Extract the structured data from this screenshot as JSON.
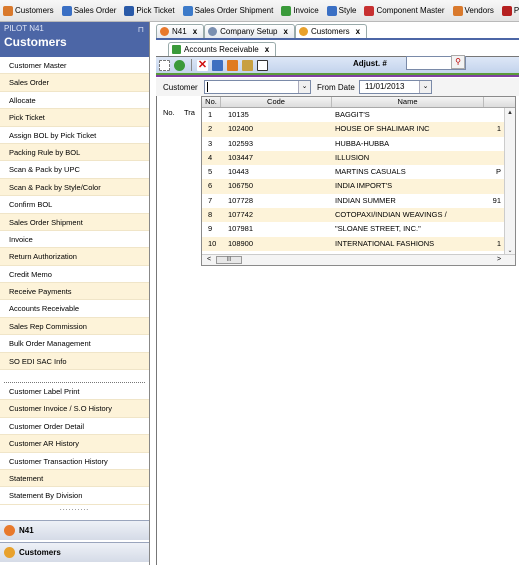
{
  "toolbar": {
    "items": [
      {
        "label": "Customers",
        "icon": "customers-icon",
        "color": "#d9792c"
      },
      {
        "label": "Sales Order",
        "icon": "sales-order-icon",
        "color": "#3a6fc4"
      },
      {
        "label": "Pick Ticket",
        "icon": "pick-ticket-icon",
        "color": "#2a5aa8"
      },
      {
        "label": "Sales Order Shipment",
        "icon": "shipment-icon",
        "color": "#3c7ac9"
      },
      {
        "label": "Invoice",
        "icon": "invoice-icon",
        "color": "#3a9a3a"
      },
      {
        "label": "Style",
        "icon": "style-icon",
        "color": "#3a6fc4"
      },
      {
        "label": "Component Master",
        "icon": "component-master-icon",
        "color": "#c73030"
      },
      {
        "label": "Vendors",
        "icon": "vendors-icon",
        "color": "#d9792c"
      },
      {
        "label": "Pr",
        "icon": "production-icon",
        "color": "#b52020"
      }
    ]
  },
  "sidebar": {
    "subtitle": "PILOT N41",
    "title": "Customers",
    "pin": "⊓",
    "items": [
      "Customer Master",
      "Sales Order",
      "Allocate",
      "Pick Ticket",
      "Assign BOL by Pick Ticket",
      "Packing Rule by BOL",
      "Scan & Pack by UPC",
      "Scan & Pack by Style/Color",
      "Confirm BOL",
      "Sales Order Shipment",
      "Invoice",
      "Return Authorization",
      "Credit Memo",
      "Receive Payments",
      "Accounts Receivable",
      "Sales Rep Commission",
      "Bulk Order Management",
      "SO EDI SAC Info"
    ],
    "items2": [
      "Customer Label Print",
      "Customer Invoice / S.O History",
      "Customer Order Detail",
      "Customer AR History",
      "Customer Transaction History",
      "Statement",
      "Statement By Division"
    ],
    "grip": "..........",
    "nav": [
      {
        "label": "N41",
        "color": "#e8792c"
      },
      {
        "label": "Customers",
        "color": "#e8a12c"
      }
    ]
  },
  "tabs": {
    "top": [
      {
        "label": "N41",
        "close": "x"
      },
      {
        "label": "Company Setup",
        "close": "x"
      },
      {
        "label": "Customers",
        "close": "x"
      }
    ],
    "sub": [
      {
        "label": "Accounts Receivable",
        "close": "x"
      }
    ]
  },
  "form": {
    "adjust_label": "Adjust. #",
    "customer_label": "Customer",
    "from_date_label": "From Date",
    "from_date_value": "11/01/2013",
    "grid_head_no": "No.",
    "grid_head_tra": "Tra"
  },
  "dropdown": {
    "columns": [
      "No.",
      "Code",
      "Name"
    ],
    "rows": [
      {
        "no": "1",
        "code": "10135",
        "name": "BAGGIT'S",
        "extra": ""
      },
      {
        "no": "2",
        "code": "102400",
        "name": "HOUSE OF SHALIMAR INC",
        "extra": "1"
      },
      {
        "no": "3",
        "code": "102593",
        "name": "HUBBA-HUBBA",
        "extra": ""
      },
      {
        "no": "4",
        "code": "103447",
        "name": "ILLUSION",
        "extra": ""
      },
      {
        "no": "5",
        "code": "10443",
        "name": "MARTINS CASUALS",
        "extra": "P"
      },
      {
        "no": "6",
        "code": "106750",
        "name": "INDIA IMPORT'S",
        "extra": ""
      },
      {
        "no": "7",
        "code": "107728",
        "name": "INDIAN SUMMER",
        "extra": "91"
      },
      {
        "no": "8",
        "code": "107742",
        "name": "COTOPAXI/INDIAN WEAVINGS /",
        "extra": ""
      },
      {
        "no": "9",
        "code": "107981",
        "name": "\"SLOANE STREET, INC.\"",
        "extra": ""
      },
      {
        "no": "10",
        "code": "108900",
        "name": "INTERNATIONAL FASHIONS",
        "extra": "1"
      }
    ],
    "scroll_thumb": "III"
  }
}
